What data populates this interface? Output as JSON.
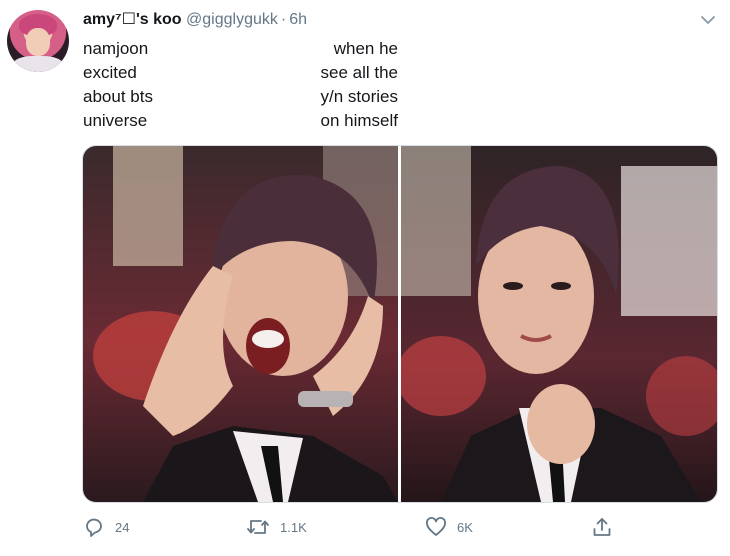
{
  "tweet": {
    "display_name": "amy⁷☐'s koo",
    "handle": "@gigglygukk",
    "separator": "·",
    "time": "6h",
    "text_left": [
      "namjoon",
      "excited",
      "about bts",
      "universe"
    ],
    "text_right": [
      "when he",
      "see all the",
      "y/n stories",
      "on himself"
    ]
  },
  "actions": {
    "replies": "24",
    "retweets": "1.1K",
    "likes": "6K"
  },
  "icons": {
    "caret": "chevron-down-icon",
    "reply": "reply-bubble-icon",
    "retweet": "retweet-icon",
    "like": "heart-icon",
    "share": "share-icon"
  },
  "colors": {
    "text_primary": "#14171a",
    "text_secondary": "#657786",
    "photo_stage_red": "#a2263a",
    "photo_suit": "#1b1619"
  }
}
